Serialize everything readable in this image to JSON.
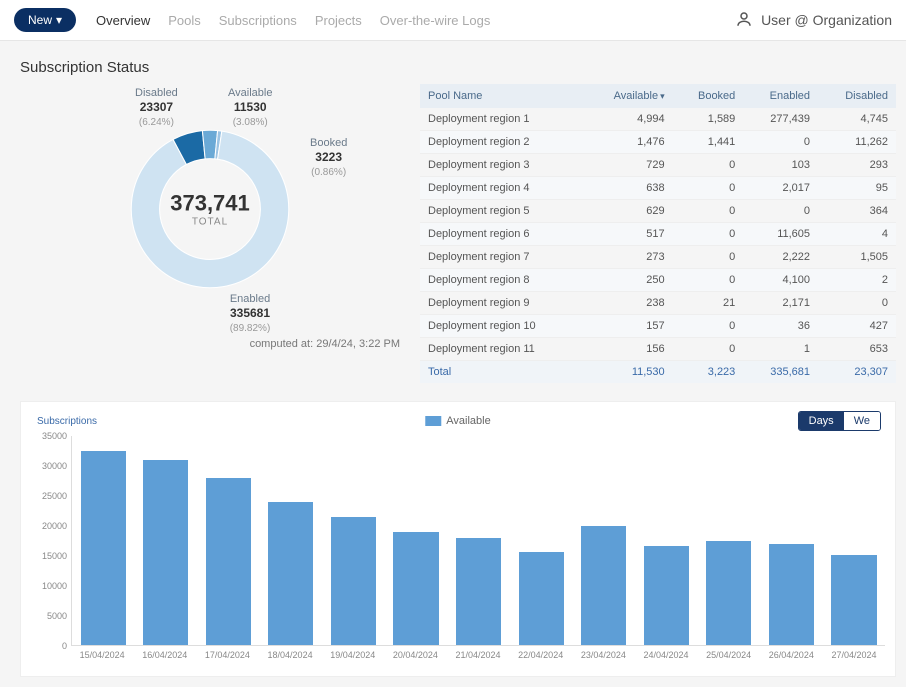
{
  "topbar": {
    "new_button": "New",
    "nav": [
      "Overview",
      "Pools",
      "Subscriptions",
      "Projects",
      "Over-the-wire Logs"
    ],
    "active_nav_index": 0,
    "user_label": "User @ Organization"
  },
  "status": {
    "title": "Subscription Status",
    "total_label": "TOTAL",
    "total_value": "373,741",
    "segments": [
      {
        "name": "Disabled",
        "value": "23307",
        "pct": "(6.24%)"
      },
      {
        "name": "Available",
        "value": "11530",
        "pct": "(3.08%)"
      },
      {
        "name": "Booked",
        "value": "3223",
        "pct": "(0.86%)"
      },
      {
        "name": "Enabled",
        "value": "335681",
        "pct": "(89.82%)"
      }
    ],
    "computed_at": "computed at: 29/4/24, 3:22 PM"
  },
  "table": {
    "headers": [
      "Pool Name",
      "Available",
      "Booked",
      "Enabled",
      "Disabled"
    ],
    "sort_col": 1,
    "rows": [
      {
        "name": "Deployment region 1",
        "available": "4,994",
        "booked": "1,589",
        "enabled": "277,439",
        "disabled": "4,745"
      },
      {
        "name": "Deployment region 2",
        "available": "1,476",
        "booked": "1,441",
        "enabled": "0",
        "disabled": "11,262"
      },
      {
        "name": "Deployment region 3",
        "available": "729",
        "booked": "0",
        "enabled": "103",
        "disabled": "293"
      },
      {
        "name": "Deployment region 4",
        "available": "638",
        "booked": "0",
        "enabled": "2,017",
        "disabled": "95"
      },
      {
        "name": "Deployment region 5",
        "available": "629",
        "booked": "0",
        "enabled": "0",
        "disabled": "364"
      },
      {
        "name": "Deployment region 6",
        "available": "517",
        "booked": "0",
        "enabled": "11,605",
        "disabled": "4"
      },
      {
        "name": "Deployment region 7",
        "available": "273",
        "booked": "0",
        "enabled": "2,222",
        "disabled": "1,505"
      },
      {
        "name": "Deployment region 8",
        "available": "250",
        "booked": "0",
        "enabled": "4,100",
        "disabled": "2"
      },
      {
        "name": "Deployment region 9",
        "available": "238",
        "booked": "21",
        "enabled": "2,171",
        "disabled": "0"
      },
      {
        "name": "Deployment region 10",
        "available": "157",
        "booked": "0",
        "enabled": "36",
        "disabled": "427"
      },
      {
        "name": "Deployment region 11",
        "available": "156",
        "booked": "0",
        "enabled": "1",
        "disabled": "653"
      }
    ],
    "totals": {
      "label": "Total",
      "available": "11,530",
      "booked": "3,223",
      "enabled": "335,681",
      "disabled": "23,307"
    }
  },
  "barchart": {
    "y_title": "Subscriptions",
    "legend_label": "Available",
    "toggle": {
      "options": [
        "Days",
        "We"
      ],
      "active_index": 0
    }
  },
  "chart_data": [
    {
      "type": "donut",
      "title": "Subscription Status",
      "total": 373741,
      "series": [
        {
          "name": "Disabled",
          "value": 23307,
          "pct": 6.24,
          "color": "#1b6aa5"
        },
        {
          "name": "Available",
          "value": 11530,
          "pct": 3.08,
          "color": "#6aa9d6"
        },
        {
          "name": "Booked",
          "value": 3223,
          "pct": 0.86,
          "color": "#9cc4e4"
        },
        {
          "name": "Enabled",
          "value": 335681,
          "pct": 89.82,
          "color": "#cfe3f2"
        }
      ]
    },
    {
      "type": "bar",
      "title": "Subscriptions",
      "legend": [
        "Available"
      ],
      "xlabel": "",
      "ylabel": "Subscriptions",
      "ylim": [
        0,
        35000
      ],
      "yticks": [
        0,
        5000,
        10000,
        15000,
        20000,
        25000,
        30000,
        35000
      ],
      "categories": [
        "15/04/2024",
        "16/04/2024",
        "17/04/2024",
        "18/04/2024",
        "19/04/2024",
        "20/04/2024",
        "21/04/2024",
        "22/04/2024",
        "23/04/2024",
        "24/04/2024",
        "25/04/2024",
        "26/04/2024",
        "27/04/2024"
      ],
      "values": [
        32500,
        31000,
        28000,
        24000,
        21500,
        19000,
        18000,
        15500,
        20000,
        16500,
        17500,
        17000,
        15000
      ]
    }
  ]
}
